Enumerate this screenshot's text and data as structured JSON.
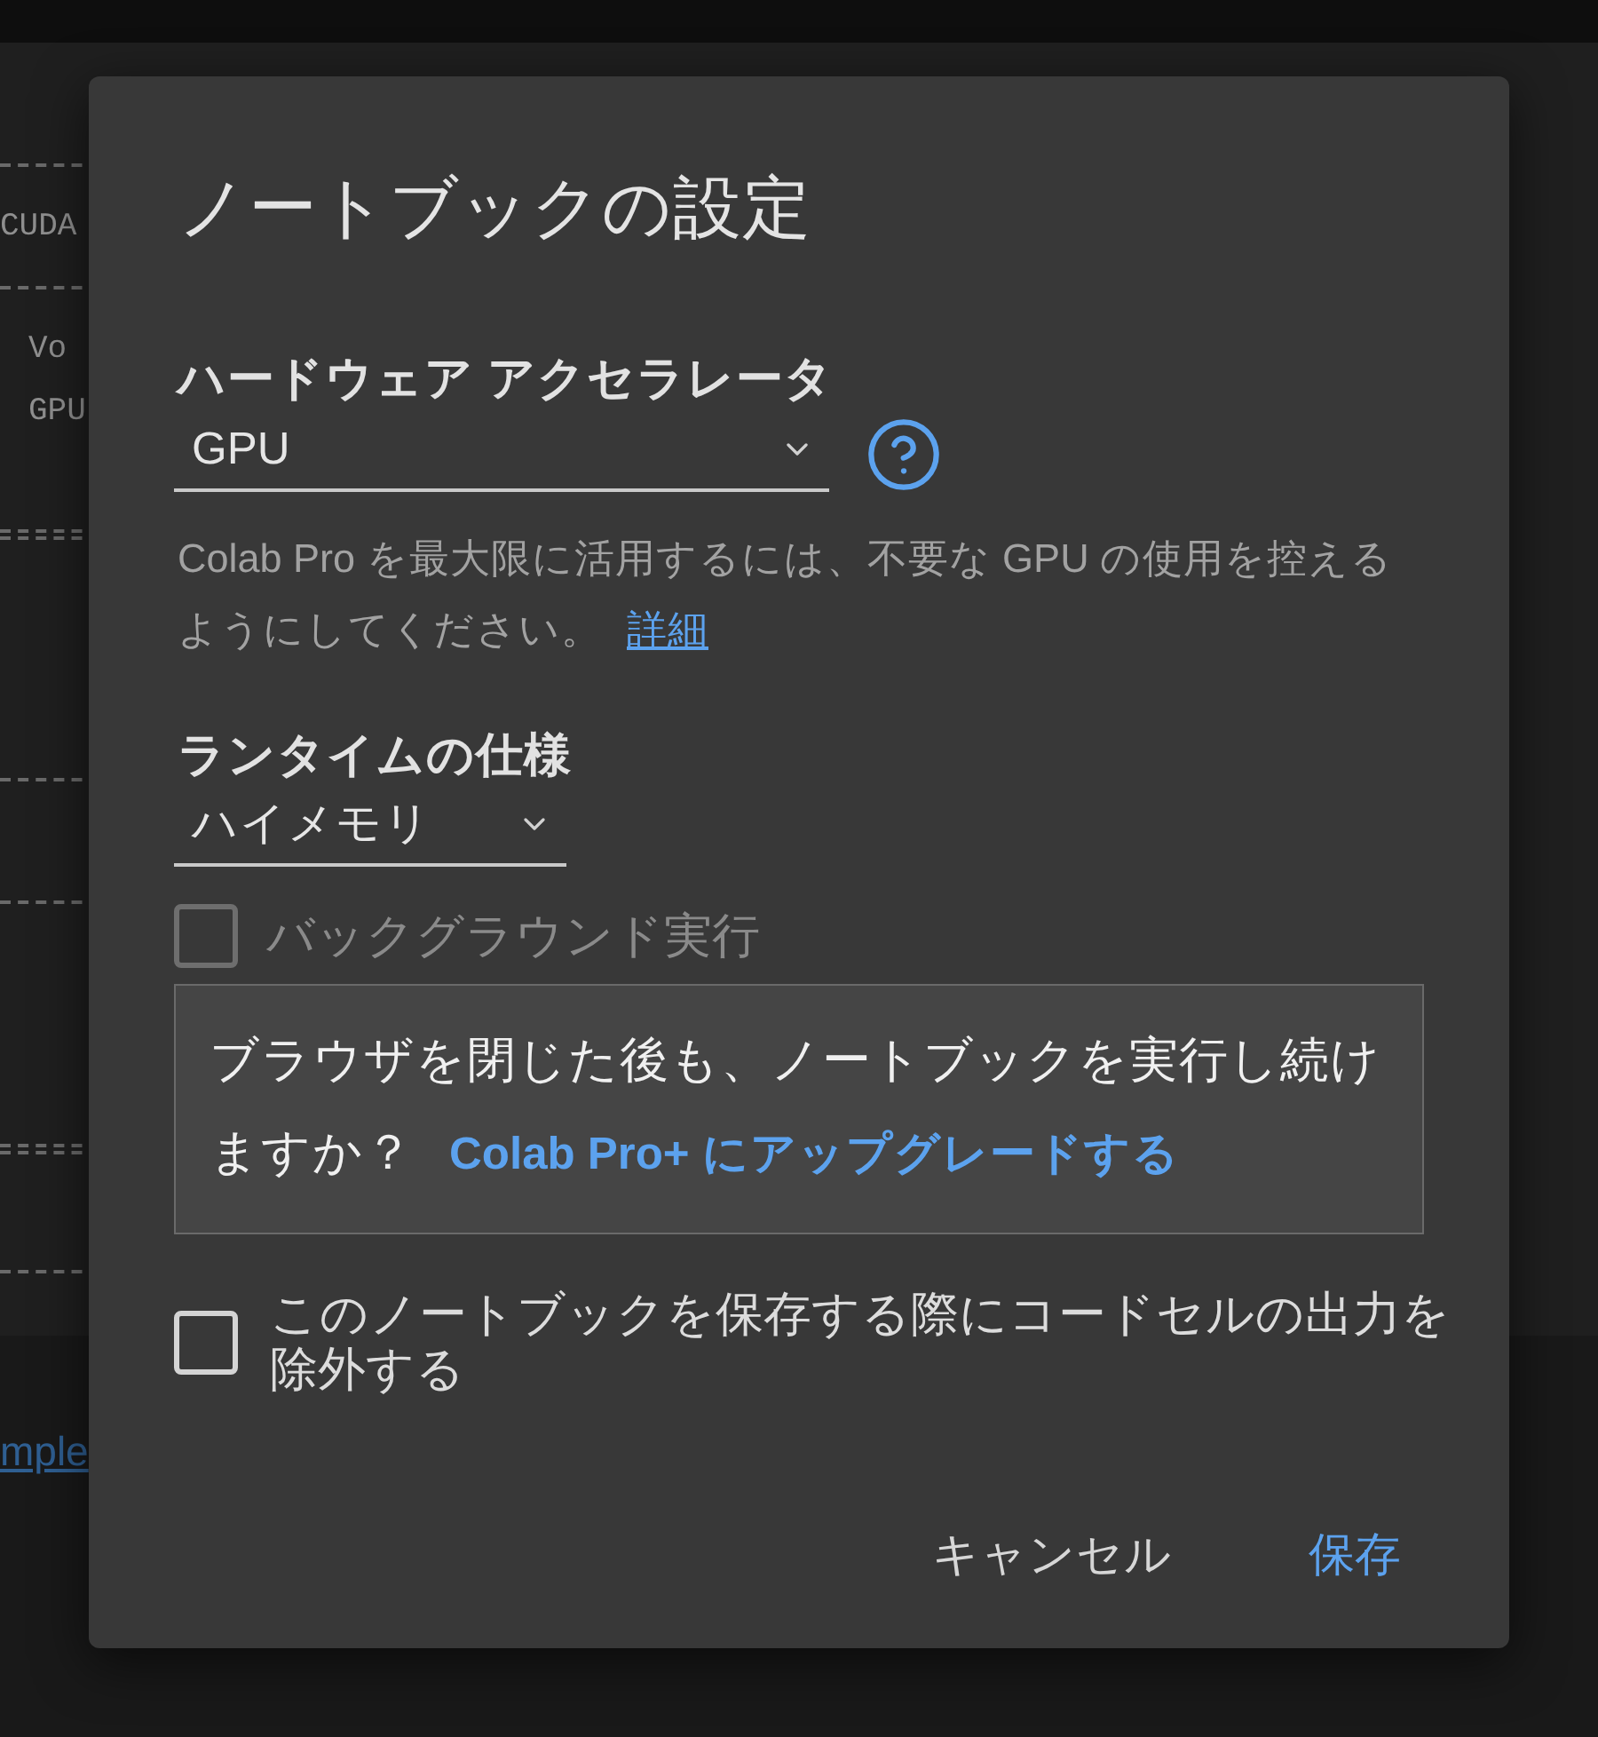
{
  "notebook_output": {
    "lines": [
      {
        "kind": "rule"
      },
      {
        "kind": "text",
        "text": "CUDA"
      },
      {
        "kind": "rule"
      },
      {
        "kind": "indented_text",
        "text": "Vo"
      },
      {
        "kind": "indented_text",
        "text": "GPU"
      },
      {
        "kind": "blank"
      },
      {
        "kind": "double_rule"
      },
      {
        "kind": "blank"
      },
      {
        "kind": "blank"
      },
      {
        "kind": "blank"
      },
      {
        "kind": "rule"
      },
      {
        "kind": "blank"
      },
      {
        "kind": "rule"
      },
      {
        "kind": "blank"
      },
      {
        "kind": "blank"
      },
      {
        "kind": "blank"
      },
      {
        "kind": "double_rule"
      },
      {
        "kind": "blank"
      },
      {
        "kind": "rule"
      }
    ]
  },
  "notebook_link": "mple",
  "dialog": {
    "title": "ノートブックの設定",
    "hardware_accelerator": {
      "label": "ハードウェア アクセラレータ",
      "value": "GPU",
      "help_text": "Colab Pro を最大限に活用するには、不要な GPU の使用を控えるようにしてください。",
      "help_link": "詳細"
    },
    "runtime_shape": {
      "label": "ランタイムの仕様",
      "value": "ハイメモリ"
    },
    "background_execution": {
      "label": "バックグラウンド実行",
      "checked": false,
      "disabled": true,
      "notice": "ブラウザを閉じた後も、ノートブックを実行し続けますか？",
      "upgrade_link": "Colab Pro+ にアップグレードする"
    },
    "omit_output": {
      "label": "このノートブックを保存する際にコードセルの出力を除外する",
      "checked": false,
      "disabled": false
    },
    "buttons": [
      {
        "label": "キャンセル",
        "kind": "secondary"
      },
      {
        "label": "保存",
        "kind": "primary"
      }
    ]
  }
}
